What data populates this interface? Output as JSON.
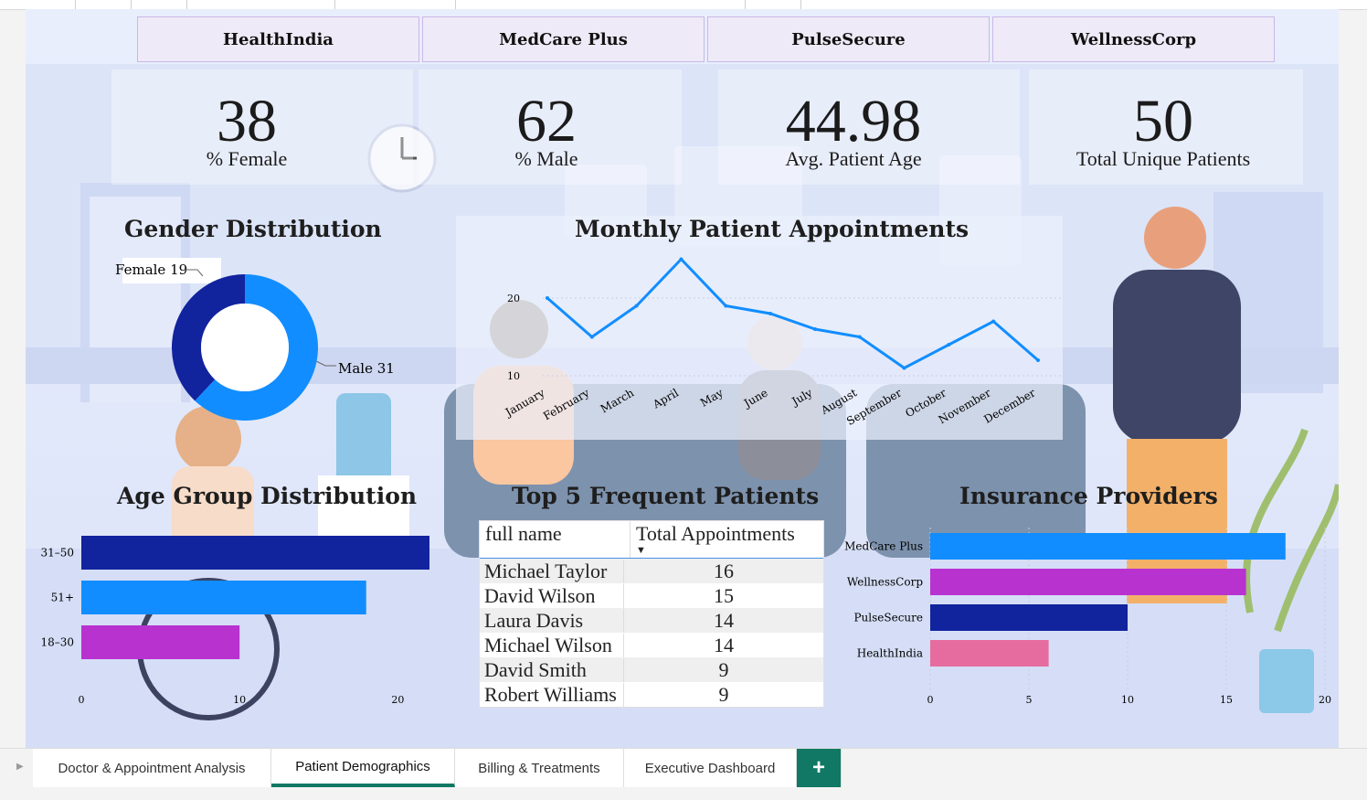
{
  "filters": [
    "HealthIndia",
    "MedCare Plus",
    "PulseSecure",
    "WellnessCorp"
  ],
  "kpis": [
    {
      "value": "38",
      "label": "% Female"
    },
    {
      "value": "62",
      "label": "% Male"
    },
    {
      "value": "44.98",
      "label": "Avg. Patient Age"
    },
    {
      "value": "50",
      "label": "Total Unique Patients"
    }
  ],
  "gender": {
    "title": "Gender Distribution",
    "female_label": "Female 19",
    "male_label": "Male 31"
  },
  "monthly": {
    "title": "Monthly Patient Appointments"
  },
  "age": {
    "title": "Age Group Distribution"
  },
  "top5": {
    "title": "Top 5 Frequent Patients",
    "col1": "full name",
    "col2": "Total Appointments",
    "rows": [
      {
        "name": "Michael Taylor",
        "count": "16"
      },
      {
        "name": "David Wilson",
        "count": "15"
      },
      {
        "name": "Laura Davis",
        "count": "14"
      },
      {
        "name": "Michael Wilson",
        "count": "14"
      },
      {
        "name": "David Smith",
        "count": "9"
      },
      {
        "name": "Robert Williams",
        "count": "9"
      }
    ]
  },
  "insurance": {
    "title": "Insurance Providers"
  },
  "tabs": {
    "t1": "Doctor & Appointment Analysis",
    "t2": "Patient Demographics",
    "t3": "Billing & Treatments",
    "t4": "Executive Dashboard",
    "add": "+"
  },
  "colors": {
    "navy": "#12239e",
    "blue": "#118dff",
    "purple": "#b832d0",
    "pink": "#e66c9f",
    "tab_accent": "#117865"
  },
  "chart_data": [
    {
      "type": "pie",
      "title": "Gender Distribution",
      "categories": [
        "Female",
        "Male"
      ],
      "values": [
        19,
        31
      ],
      "colors": [
        "#12239e",
        "#118dff"
      ]
    },
    {
      "type": "line",
      "title": "Monthly Patient Appointments",
      "x": [
        "January",
        "February",
        "March",
        "April",
        "May",
        "June",
        "July",
        "August",
        "September",
        "October",
        "November",
        "December"
      ],
      "values": [
        20,
        15,
        19,
        25,
        19,
        18,
        16,
        15,
        11,
        14,
        17,
        12
      ],
      "yticks": [
        10,
        20
      ],
      "ylim": [
        10,
        20
      ]
    },
    {
      "type": "bar",
      "title": "Age Group Distribution",
      "categories": [
        "31–50",
        "51+",
        "18–30"
      ],
      "values": [
        22,
        18,
        10
      ],
      "colors": [
        "#12239e",
        "#118dff",
        "#b832d0"
      ],
      "xticks": [
        0,
        10,
        20
      ],
      "xlim": [
        0,
        22
      ]
    },
    {
      "type": "bar",
      "title": "Insurance Providers",
      "categories": [
        "MedCare Plus",
        "WellnessCorp",
        "PulseSecure",
        "HealthIndia"
      ],
      "values": [
        18,
        16,
        10,
        6
      ],
      "colors": [
        "#118dff",
        "#b832d0",
        "#12239e",
        "#e66c9f"
      ],
      "xticks": [
        0,
        5,
        10,
        15,
        20
      ],
      "xlim": [
        0,
        20
      ]
    }
  ]
}
